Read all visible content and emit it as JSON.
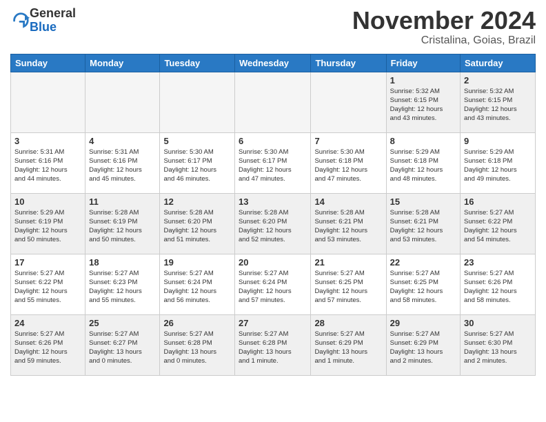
{
  "header": {
    "logo_general": "General",
    "logo_blue": "Blue",
    "month_title": "November 2024",
    "location": "Cristalina, Goias, Brazil"
  },
  "days_of_week": [
    "Sunday",
    "Monday",
    "Tuesday",
    "Wednesday",
    "Thursday",
    "Friday",
    "Saturday"
  ],
  "weeks": [
    [
      {
        "day": "",
        "info": ""
      },
      {
        "day": "",
        "info": ""
      },
      {
        "day": "",
        "info": ""
      },
      {
        "day": "",
        "info": ""
      },
      {
        "day": "",
        "info": ""
      },
      {
        "day": "1",
        "info": "Sunrise: 5:32 AM\nSunset: 6:15 PM\nDaylight: 12 hours\nand 43 minutes."
      },
      {
        "day": "2",
        "info": "Sunrise: 5:32 AM\nSunset: 6:15 PM\nDaylight: 12 hours\nand 43 minutes."
      }
    ],
    [
      {
        "day": "3",
        "info": "Sunrise: 5:31 AM\nSunset: 6:16 PM\nDaylight: 12 hours\nand 44 minutes."
      },
      {
        "day": "4",
        "info": "Sunrise: 5:31 AM\nSunset: 6:16 PM\nDaylight: 12 hours\nand 45 minutes."
      },
      {
        "day": "5",
        "info": "Sunrise: 5:30 AM\nSunset: 6:17 PM\nDaylight: 12 hours\nand 46 minutes."
      },
      {
        "day": "6",
        "info": "Sunrise: 5:30 AM\nSunset: 6:17 PM\nDaylight: 12 hours\nand 47 minutes."
      },
      {
        "day": "7",
        "info": "Sunrise: 5:30 AM\nSunset: 6:18 PM\nDaylight: 12 hours\nand 47 minutes."
      },
      {
        "day": "8",
        "info": "Sunrise: 5:29 AM\nSunset: 6:18 PM\nDaylight: 12 hours\nand 48 minutes."
      },
      {
        "day": "9",
        "info": "Sunrise: 5:29 AM\nSunset: 6:18 PM\nDaylight: 12 hours\nand 49 minutes."
      }
    ],
    [
      {
        "day": "10",
        "info": "Sunrise: 5:29 AM\nSunset: 6:19 PM\nDaylight: 12 hours\nand 50 minutes."
      },
      {
        "day": "11",
        "info": "Sunrise: 5:28 AM\nSunset: 6:19 PM\nDaylight: 12 hours\nand 50 minutes."
      },
      {
        "day": "12",
        "info": "Sunrise: 5:28 AM\nSunset: 6:20 PM\nDaylight: 12 hours\nand 51 minutes."
      },
      {
        "day": "13",
        "info": "Sunrise: 5:28 AM\nSunset: 6:20 PM\nDaylight: 12 hours\nand 52 minutes."
      },
      {
        "day": "14",
        "info": "Sunrise: 5:28 AM\nSunset: 6:21 PM\nDaylight: 12 hours\nand 53 minutes."
      },
      {
        "day": "15",
        "info": "Sunrise: 5:28 AM\nSunset: 6:21 PM\nDaylight: 12 hours\nand 53 minutes."
      },
      {
        "day": "16",
        "info": "Sunrise: 5:27 AM\nSunset: 6:22 PM\nDaylight: 12 hours\nand 54 minutes."
      }
    ],
    [
      {
        "day": "17",
        "info": "Sunrise: 5:27 AM\nSunset: 6:22 PM\nDaylight: 12 hours\nand 55 minutes."
      },
      {
        "day": "18",
        "info": "Sunrise: 5:27 AM\nSunset: 6:23 PM\nDaylight: 12 hours\nand 55 minutes."
      },
      {
        "day": "19",
        "info": "Sunrise: 5:27 AM\nSunset: 6:24 PM\nDaylight: 12 hours\nand 56 minutes."
      },
      {
        "day": "20",
        "info": "Sunrise: 5:27 AM\nSunset: 6:24 PM\nDaylight: 12 hours\nand 57 minutes."
      },
      {
        "day": "21",
        "info": "Sunrise: 5:27 AM\nSunset: 6:25 PM\nDaylight: 12 hours\nand 57 minutes."
      },
      {
        "day": "22",
        "info": "Sunrise: 5:27 AM\nSunset: 6:25 PM\nDaylight: 12 hours\nand 58 minutes."
      },
      {
        "day": "23",
        "info": "Sunrise: 5:27 AM\nSunset: 6:26 PM\nDaylight: 12 hours\nand 58 minutes."
      }
    ],
    [
      {
        "day": "24",
        "info": "Sunrise: 5:27 AM\nSunset: 6:26 PM\nDaylight: 12 hours\nand 59 minutes."
      },
      {
        "day": "25",
        "info": "Sunrise: 5:27 AM\nSunset: 6:27 PM\nDaylight: 13 hours\nand 0 minutes."
      },
      {
        "day": "26",
        "info": "Sunrise: 5:27 AM\nSunset: 6:28 PM\nDaylight: 13 hours\nand 0 minutes."
      },
      {
        "day": "27",
        "info": "Sunrise: 5:27 AM\nSunset: 6:28 PM\nDaylight: 13 hours\nand 1 minute."
      },
      {
        "day": "28",
        "info": "Sunrise: 5:27 AM\nSunset: 6:29 PM\nDaylight: 13 hours\nand 1 minute."
      },
      {
        "day": "29",
        "info": "Sunrise: 5:27 AM\nSunset: 6:29 PM\nDaylight: 13 hours\nand 2 minutes."
      },
      {
        "day": "30",
        "info": "Sunrise: 5:27 AM\nSunset: 6:30 PM\nDaylight: 13 hours\nand 2 minutes."
      }
    ]
  ]
}
